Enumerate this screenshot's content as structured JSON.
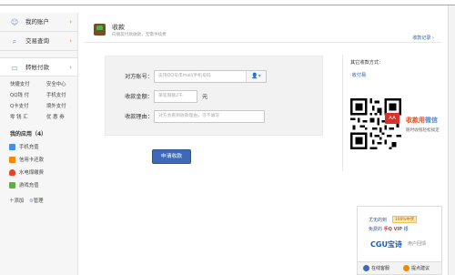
{
  "sidebar": {
    "nav": [
      {
        "label": "我的账户",
        "icon": "user-icon"
      },
      {
        "label": "交易查询",
        "icon": "search-icon"
      },
      {
        "label": "转帐付款",
        "icon": "card-icon"
      }
    ],
    "sub_links": [
      "快捷支付",
      "安全中心",
      "QQ钱 付",
      "手机支付",
      "Q卡支付",
      "境外支付",
      "零 钱 汇",
      "优 惠 券"
    ],
    "apps_title": "我的应用（4）",
    "apps": [
      {
        "label": "手机充值",
        "icon": "phone-icon",
        "color": "#4a8fdc"
      },
      {
        "label": "信用卡还款",
        "icon": "credit-card-icon",
        "color": "#f08a00"
      },
      {
        "label": "水电煤缴费",
        "icon": "flame-icon",
        "color": "#e2452a"
      },
      {
        "label": "游戏充值",
        "icon": "gamepad-icon",
        "color": "#6aa84f"
      }
    ],
    "add_label": "＋添加",
    "manage_label": "管理"
  },
  "header": {
    "title": "收款",
    "subtitle": "向朋友付款收款，无需手续费",
    "link": "收款记录 ›"
  },
  "form": {
    "account_label": "对方账号：",
    "account_placeholder": "支持QQ号/Email/手机号码",
    "amount_label": "收款金额：",
    "amount_placeholder": "单笔限额2千",
    "amount_unit": "元",
    "reason_label": "收款理由：",
    "reason_placeholder": "对方会看到收款理由，可不填写",
    "submit_label": "申请收款"
  },
  "right_panel": {
    "title": "其它收款方式：",
    "link": "·收付易",
    "aa_badge": "AA",
    "brand_a": "收款用",
    "brand_b": "微信",
    "desc": "随时收钱轻松搞定"
  },
  "ad": {
    "line1": "尤无的到",
    "badge": "100%中奖",
    "line2_a": "免费的",
    "line2_b": "手Q VIP",
    "line2_c": "银",
    "logo": "CGU宝诗",
    "tag": "用户回馈",
    "btn_service": "在线客服",
    "btn_feedback": "提点建议"
  },
  "colors": {
    "accent": "#3e6ab5",
    "orange": "#f07800",
    "link": "#2a5ca8"
  }
}
